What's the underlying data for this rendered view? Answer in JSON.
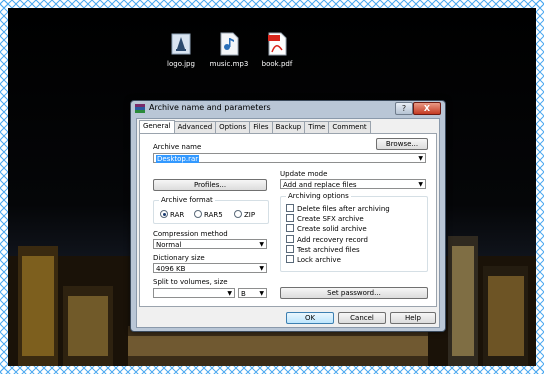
{
  "desktop": {
    "icons": [
      {
        "label": "logo.jpg",
        "icon": "image-file-icon"
      },
      {
        "label": "music.mp3",
        "icon": "audio-file-icon"
      },
      {
        "label": "book.pdf",
        "icon": "pdf-file-icon"
      }
    ]
  },
  "dialog": {
    "title": "Archive name and parameters",
    "help_glyph": "?",
    "close_glyph": "X",
    "tabs": [
      "General",
      "Advanced",
      "Options",
      "Files",
      "Backup",
      "Time",
      "Comment"
    ],
    "active_tab": "General",
    "archive_name_label": "Archive name",
    "archive_name_value": "Desktop.rar",
    "browse_button": "Browse...",
    "profiles_button": "Profiles...",
    "update_mode_label": "Update mode",
    "update_mode_value": "Add and replace files",
    "archive_format": {
      "label": "Archive format",
      "options": [
        "RAR",
        "RAR5",
        "ZIP"
      ],
      "selected": "RAR"
    },
    "compression_label": "Compression method",
    "compression_value": "Normal",
    "dictionary_label": "Dictionary size",
    "dictionary_value": "4096 KB",
    "split_label": "Split to volumes, size",
    "split_value": "",
    "split_unit": "B",
    "archiving_options": {
      "label": "Archiving options",
      "items": [
        "Delete files after archiving",
        "Create SFX archive",
        "Create solid archive",
        "Add recovery record",
        "Test archived files",
        "Lock archive"
      ]
    },
    "set_password_button": "Set password...",
    "ok_button": "OK",
    "cancel_button": "Cancel",
    "help_button": "Help"
  },
  "colors": {
    "frame": "#4aa8f0",
    "selection": "#3399ff",
    "dialog_chrome": "#b9c6d6",
    "close_button": "#c43a23"
  }
}
